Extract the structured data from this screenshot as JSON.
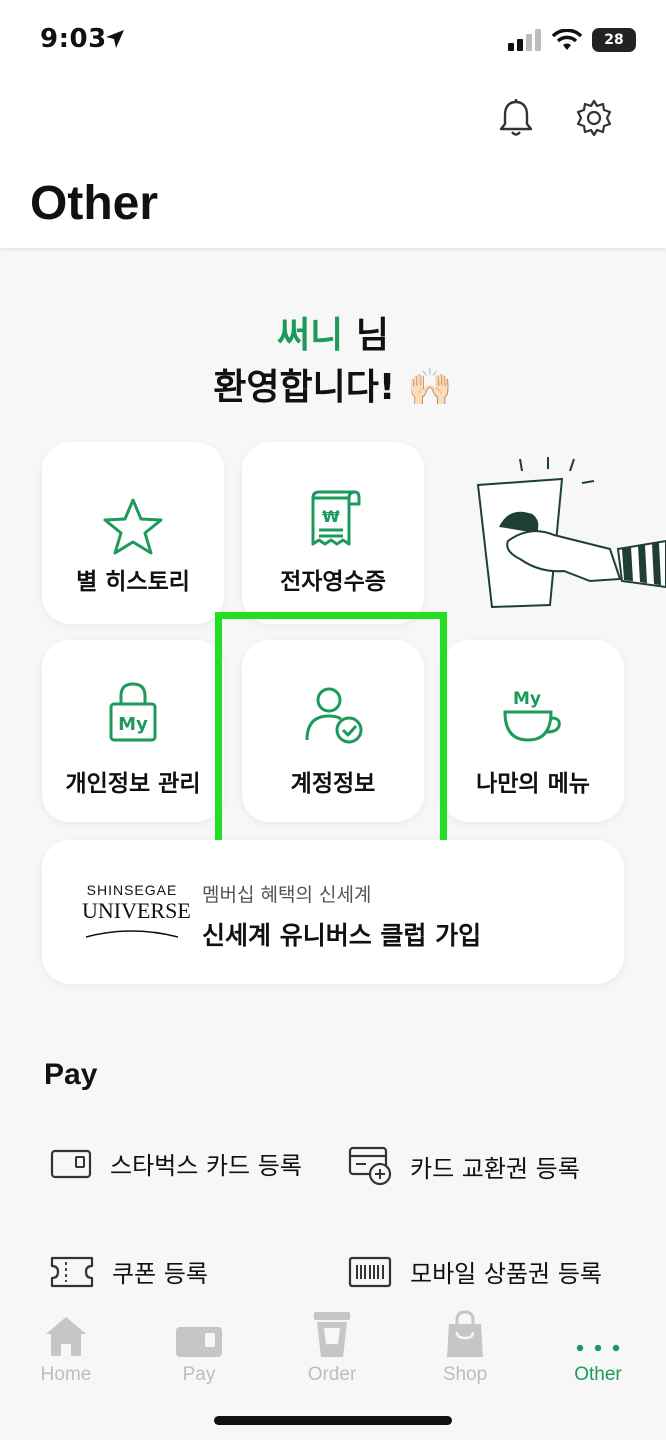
{
  "status_bar": {
    "time": "9:03",
    "battery": "28"
  },
  "header": {
    "title": "Other",
    "bell_icon": "bell-icon",
    "settings_icon": "gear-icon"
  },
  "welcome": {
    "name": "써니",
    "suffix": " 님",
    "line2": "환영합니다! 🙌🏻"
  },
  "tiles": {
    "star_history": "별 히스토리",
    "e_receipt": "전자영수증",
    "privacy": "개인정보 관리",
    "account": "계정정보",
    "my_menu": "나만의 메뉴"
  },
  "banner": {
    "logo_top": "SHINSEGAE",
    "logo_bottom": "UNIVERSE",
    "subtitle": "멤버십 혜택의 신세계",
    "title": "신세계 유니버스 클럽 가입"
  },
  "pay": {
    "title": "Pay",
    "items": [
      "스타벅스 카드 등록",
      "카드 교환권 등록",
      "쿠폰 등록",
      "모바일 상품권 등록"
    ]
  },
  "tabbar": {
    "tabs": [
      "Home",
      "Pay",
      "Order",
      "Shop",
      "Other"
    ],
    "active": "Other"
  },
  "colors": {
    "brand_green": "#1b9a5b",
    "highlight_green": "#22e021",
    "inactive_gray": "#bdbdbd"
  }
}
